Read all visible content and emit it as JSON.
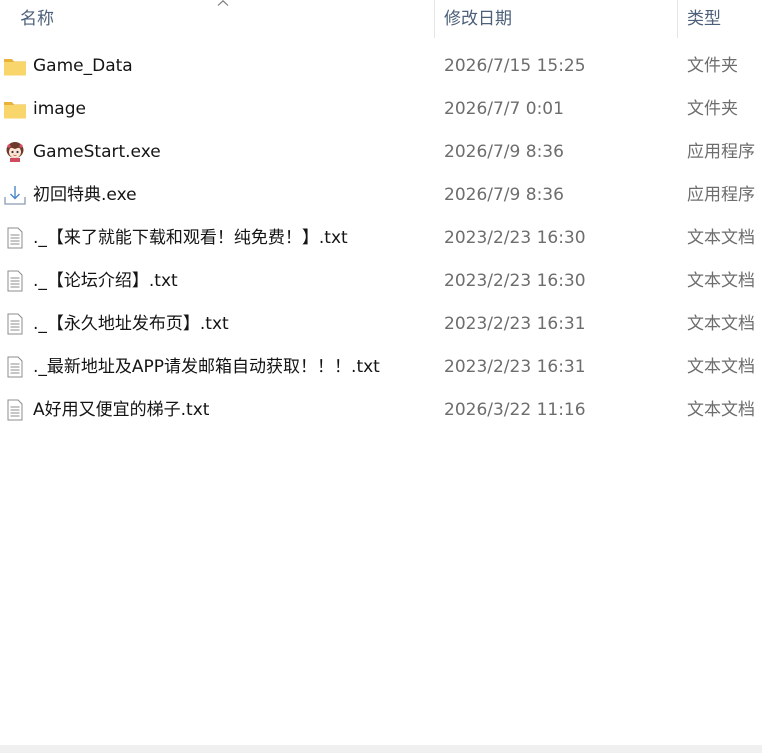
{
  "columns": {
    "name": "名称",
    "date": "修改日期",
    "type": "类型"
  },
  "files": [
    {
      "name": "Game_Data",
      "date": "2026/7/15 15:25",
      "type": "文件夹",
      "icon": "folder-icon"
    },
    {
      "name": "image",
      "date": "2026/7/7 0:01",
      "type": "文件夹",
      "icon": "folder-icon"
    },
    {
      "name": "GameStart.exe",
      "date": "2026/7/9 8:36",
      "type": "应用程序",
      "icon": "character-app-icon"
    },
    {
      "name": "初回特典.exe",
      "date": "2026/7/9 8:36",
      "type": "应用程序",
      "icon": "installer-icon"
    },
    {
      "name": "._【来了就能下载和观看！纯免费！】.txt",
      "date": "2023/2/23 16:30",
      "type": "文本文档",
      "icon": "text-file-icon"
    },
    {
      "name": "._【论坛介绍】.txt",
      "date": "2023/2/23 16:30",
      "type": "文本文档",
      "icon": "text-file-icon"
    },
    {
      "name": "._【永久地址发布页】.txt",
      "date": "2023/2/23 16:31",
      "type": "文本文档",
      "icon": "text-file-icon"
    },
    {
      "name": "._最新地址及APP请发邮箱自动获取！！！.txt",
      "date": "2023/2/23 16:31",
      "type": "文本文档",
      "icon": "text-file-icon"
    },
    {
      "name": "A好用又便宜的梯子.txt",
      "date": "2026/3/22 11:16",
      "type": "文本文档",
      "icon": "text-file-icon"
    }
  ],
  "colors": {
    "header_text": "#4c607a",
    "folder": "#f8d66b",
    "folder_tab": "#e8b33a"
  }
}
